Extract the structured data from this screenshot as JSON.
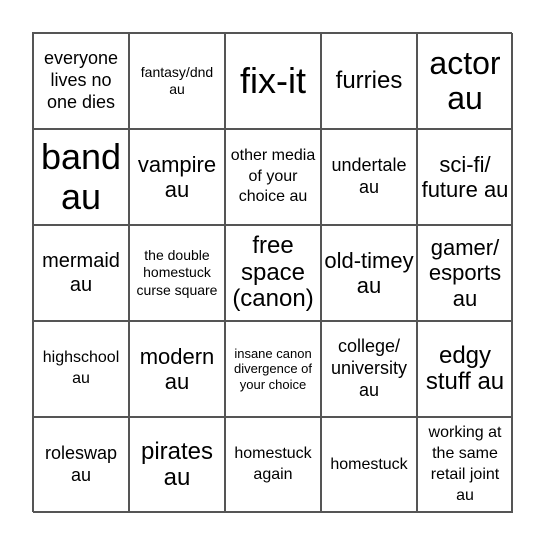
{
  "board": {
    "cells": [
      {
        "text": "everyone lives no one dies",
        "size": "s18"
      },
      {
        "text": "fantasy/dnd au",
        "size": "s14"
      },
      {
        "text": "fix-it",
        "size": "s36"
      },
      {
        "text": "furries",
        "size": "s24"
      },
      {
        "text": "actor au",
        "size": "s32"
      },
      {
        "text": "band au",
        "size": "s36"
      },
      {
        "text": "vampire au",
        "size": "s22"
      },
      {
        "text": "other media of your choice au",
        "size": "s16"
      },
      {
        "text": "undertale au",
        "size": "s18"
      },
      {
        "text": "sci-fi/ future au",
        "size": "s22"
      },
      {
        "text": "mermaid au",
        "size": "s20"
      },
      {
        "text": "the double homestuck curse square",
        "size": "s14"
      },
      {
        "text": "free space (canon)",
        "size": "s24"
      },
      {
        "text": "old-timey au",
        "size": "s22"
      },
      {
        "text": "gamer/ esports au",
        "size": "s22"
      },
      {
        "text": "highschool au",
        "size": "s16"
      },
      {
        "text": "modern au",
        "size": "s22"
      },
      {
        "text": "insane canon divergence of your choice",
        "size": "s13"
      },
      {
        "text": "college/ university au",
        "size": "s18"
      },
      {
        "text": "edgy stuff au",
        "size": "s24"
      },
      {
        "text": "roleswap au",
        "size": "s18"
      },
      {
        "text": "pirates au",
        "size": "s24"
      },
      {
        "text": "homestuck again",
        "size": "s16"
      },
      {
        "text": "homestuck",
        "size": "s16"
      },
      {
        "text": "working at the same retail joint au",
        "size": "s16"
      }
    ]
  }
}
